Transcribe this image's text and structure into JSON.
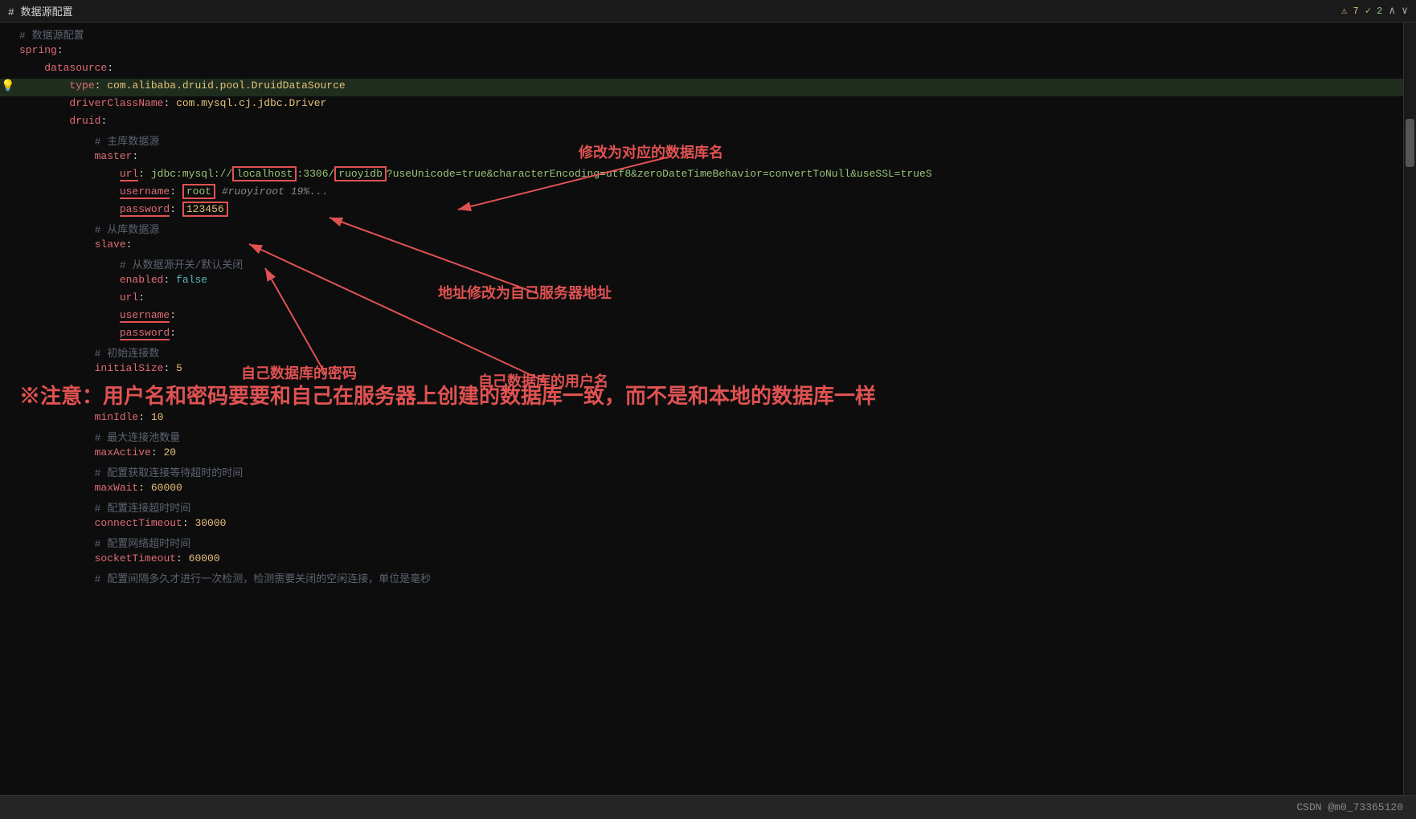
{
  "topBar": {
    "title": "#  数据源配置",
    "warning_count": "⚠ 7",
    "check_count": "✓ 2",
    "chevron_up": "∧",
    "chevron_down": "∨"
  },
  "statusBar": {
    "text": "CSDN @m0_73365120"
  },
  "annotations": {
    "db_name": "修改为对应的数据库名",
    "server_addr": "地址修改为自己服务器地址",
    "db_password": "自己数据库的密码",
    "db_username": "自己数据库的用户名",
    "notice": "※注意：用户名和密码要要和自己在服务器上创建的数据库一致，而不是和本地的数据库一样"
  },
  "code": {
    "lines": [
      {
        "num": "",
        "indent": 0,
        "content": "# 数据源配置"
      },
      {
        "num": "",
        "indent": 0,
        "content": "spring:"
      },
      {
        "num": "",
        "indent": 2,
        "content": "datasource:"
      },
      {
        "num": "",
        "indent": 4,
        "content": "type: com.alibaba.druid.pool.DruidDataSource",
        "bulb": true
      },
      {
        "num": "",
        "indent": 4,
        "content": "driverClassName: com.mysql.cj.jdbc.Driver"
      },
      {
        "num": "",
        "indent": 4,
        "content": "druid:"
      },
      {
        "num": "",
        "indent": 6,
        "content": "# 主库数据源"
      },
      {
        "num": "",
        "indent": 6,
        "content": "master:"
      },
      {
        "num": "",
        "indent": 8,
        "content": "url: jdbc:mysql://localhost:3306/ruoyidb?useUnicode=true&characterEncoding=utf8&zeroDateTimeBehavior=convertToNull&useSSL=trueS"
      },
      {
        "num": "",
        "indent": 8,
        "content": "username: root"
      },
      {
        "num": "",
        "indent": 8,
        "content": "password: 123456"
      },
      {
        "num": "",
        "indent": 6,
        "content": "# 从库数据源"
      },
      {
        "num": "",
        "indent": 6,
        "content": "slave:"
      },
      {
        "num": "",
        "indent": 8,
        "content": "# 从数据源开关/默认关闭"
      },
      {
        "num": "",
        "indent": 8,
        "content": "enabled: false"
      },
      {
        "num": "",
        "indent": 8,
        "content": "url:"
      },
      {
        "num": "",
        "indent": 8,
        "content": "username:"
      },
      {
        "num": "",
        "indent": 8,
        "content": "password:"
      },
      {
        "num": "",
        "indent": 6,
        "content": "# 初始连接数"
      },
      {
        "num": "",
        "indent": 6,
        "content": "initialSize: 5"
      },
      {
        "num": "",
        "indent": 0,
        "content": "※注意：用户名和密码要要和自己在服务器上创建的数据库一致，而不是和本地的数据库一样",
        "notice": true
      },
      {
        "num": "",
        "indent": 6,
        "content": "minIdle: 10"
      },
      {
        "num": "",
        "indent": 6,
        "content": "# 最大连接池数量"
      },
      {
        "num": "",
        "indent": 6,
        "content": "maxActive: 20"
      },
      {
        "num": "",
        "indent": 6,
        "content": "# 配置获取连接等待超时的时间"
      },
      {
        "num": "",
        "indent": 6,
        "content": "maxWait: 60000"
      },
      {
        "num": "",
        "indent": 6,
        "content": "# 配置连接超时时间"
      },
      {
        "num": "",
        "indent": 6,
        "content": "connectTimeout: 30000"
      },
      {
        "num": "",
        "indent": 6,
        "content": "# 配置网络超时时间"
      },
      {
        "num": "",
        "indent": 6,
        "content": "socketTimeout: 60000"
      },
      {
        "num": "",
        "indent": 6,
        "content": "# 配置间隔多久才进行一次检测，检测需要关闭的空闲连接，单位是毫秒"
      }
    ]
  }
}
